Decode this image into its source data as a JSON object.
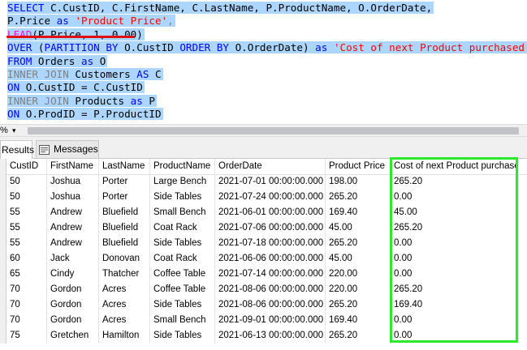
{
  "sql_lines": [
    [
      {
        "t": "SELECT",
        "c": "kw"
      },
      {
        "t": " C.CustID, C.FirstName, C.LastName, P.ProductName, O.OrderDate,",
        "c": ""
      }
    ],
    [
      {
        "t": "P.Price ",
        "c": ""
      },
      {
        "t": "as",
        "c": "kw"
      },
      {
        "t": " ",
        "c": ""
      },
      {
        "t": "'Product Price'",
        "c": "str"
      },
      {
        "t": ",",
        "c": "gray"
      }
    ],
    [
      {
        "t": "LEAD",
        "c": "fn"
      },
      {
        "t": "(P.Price, 1, 0.00)",
        "c": ""
      }
    ],
    [
      {
        "t": "OVER",
        "c": "kw"
      },
      {
        "t": " (",
        "c": ""
      },
      {
        "t": "PARTITION BY",
        "c": "kw"
      },
      {
        "t": " O.CustID ",
        "c": ""
      },
      {
        "t": "ORDER BY",
        "c": "kw"
      },
      {
        "t": " O.OrderDate) ",
        "c": ""
      },
      {
        "t": "as",
        "c": "kw"
      },
      {
        "t": " ",
        "c": ""
      },
      {
        "t": "'Cost of next Product purchased'",
        "c": "str"
      }
    ],
    [
      {
        "t": "FROM",
        "c": "kw"
      },
      {
        "t": " Orders ",
        "c": ""
      },
      {
        "t": "as",
        "c": "kw"
      },
      {
        "t": " O",
        "c": ""
      }
    ],
    [
      {
        "t": "INNER JOIN",
        "c": "gray"
      },
      {
        "t": " Customers ",
        "c": ""
      },
      {
        "t": "AS",
        "c": "kw"
      },
      {
        "t": " C",
        "c": ""
      }
    ],
    [
      {
        "t": "ON",
        "c": "kw"
      },
      {
        "t": " O.CustID = C.CustID",
        "c": ""
      }
    ],
    [
      {
        "t": "INNER JOIN",
        "c": "gray"
      },
      {
        "t": " Products ",
        "c": ""
      },
      {
        "t": "as",
        "c": "kw"
      },
      {
        "t": " P",
        "c": ""
      }
    ],
    [
      {
        "t": "ON",
        "c": "kw"
      },
      {
        "t": " O.ProdID = P.ProductID",
        "c": ""
      }
    ]
  ],
  "zoom": {
    "label": "%",
    "arrow": "▾"
  },
  "tabs": {
    "results": "Results",
    "messages": "Messages"
  },
  "columns": [
    "CustID",
    "FirstName",
    "LastName",
    "ProductName",
    "OrderDate",
    "Product Price",
    "Cost of next Product purchased"
  ],
  "rows": [
    [
      "50",
      "Joshua",
      "Porter",
      "Large Bench",
      "2021-07-01 00:00:00.000",
      "198.00",
      "265.20"
    ],
    [
      "50",
      "Joshua",
      "Porter",
      "Side Tables",
      "2021-07-24 00:00:00.000",
      "265.20",
      "0.00"
    ],
    [
      "55",
      "Andrew",
      "Bluefield",
      "Small Bench",
      "2021-06-01 00:00:00.000",
      "169.40",
      "45.00"
    ],
    [
      "55",
      "Andrew",
      "Bluefield",
      "Coat Rack",
      "2021-07-06 00:00:00.000",
      "45.00",
      "265.20"
    ],
    [
      "55",
      "Andrew",
      "Bluefield",
      "Side Tables",
      "2021-07-18 00:00:00.000",
      "265.20",
      "0.00"
    ],
    [
      "60",
      "Jack",
      "Donovan",
      "Coat Rack",
      "2021-06-06 00:00:00.000",
      "45.00",
      "0.00"
    ],
    [
      "65",
      "Cindy",
      "Thatcher",
      "Coffee Table",
      "2021-07-14 00:00:00.000",
      "220.00",
      "0.00"
    ],
    [
      "70",
      "Gordon",
      "Acres",
      "Coffee Table",
      "2021-08-06 00:00:00.000",
      "220.00",
      "265.20"
    ],
    [
      "70",
      "Gordon",
      "Acres",
      "Side Tables",
      "2021-08-06 00:00:00.000",
      "265.20",
      "169.40"
    ],
    [
      "70",
      "Gordon",
      "Acres",
      "Small Bench",
      "2021-09-01 00:00:00.000",
      "169.40",
      "0.00"
    ],
    [
      "75",
      "Gretchen",
      "Hamilton",
      "Side Tables",
      "2021-06-13 00:00:00.000",
      "265.20",
      "0.00"
    ]
  ],
  "colors": {
    "selection": "#add6ff",
    "keyword": "#0000ff",
    "string": "#ff0000",
    "function": "#ff00ff",
    "highlight_box": "#2ee82e",
    "underline": "#e01010"
  }
}
